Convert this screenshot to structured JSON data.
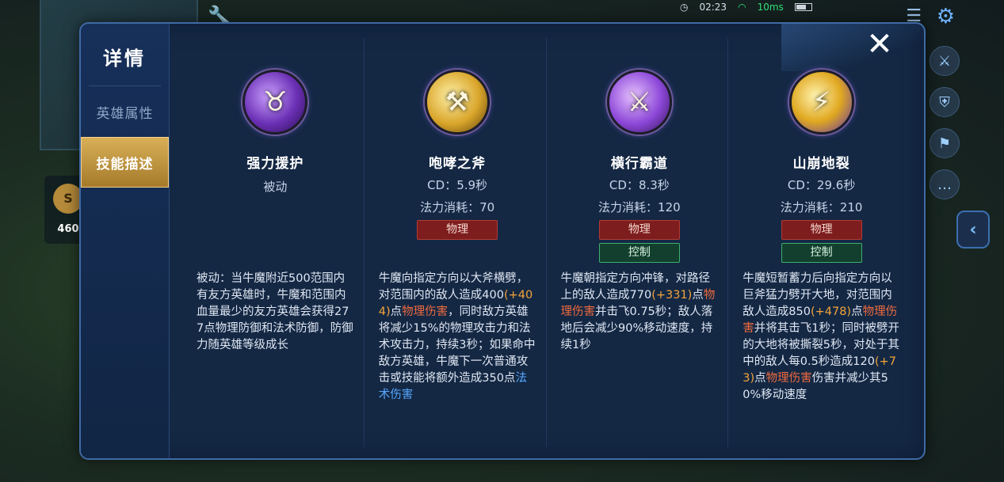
{
  "hud": {
    "time": "02:23",
    "ping": "10ms",
    "gold": "460",
    "gold_symbol": "S"
  },
  "panel": {
    "title": "详情",
    "close_label": "✕",
    "tabs": [
      {
        "label": "英雄属性",
        "active": false
      },
      {
        "label": "技能描述",
        "active": true
      }
    ]
  },
  "skills": [
    {
      "name": "强力援护",
      "type": "被动",
      "icon": "bull-guard-icon",
      "tags": [],
      "desc": [
        {
          "t": "被动：当牛魔附近500范围内有友方英雄时，牛魔和范围内血量最少的友方英雄会获得277点物理防御和法术防御，防御力随英雄等级成长"
        }
      ]
    },
    {
      "name": "咆哮之斧",
      "cd": "CD：5.9秒",
      "mana": "法力消耗：70",
      "icon": "axe-icon",
      "tags": [
        {
          "label": "物理",
          "kind": "phys"
        }
      ],
      "desc": [
        {
          "t": "牛魔向指定方向以大斧横劈，对范围内的敌人造成400"
        },
        {
          "t": "(+404)",
          "c": "num"
        },
        {
          "t": "点"
        },
        {
          "t": "物理伤害",
          "c": "dmg-p"
        },
        {
          "t": "，同时敌方英雄将减少15%的物理攻击力和法术攻击力，持续3秒；如果命中敌方英雄，牛魔下一次普通攻击或技能将额外造成350点"
        },
        {
          "t": "法术伤害",
          "c": "dmg-m"
        }
      ]
    },
    {
      "name": "横行霸道",
      "cd": "CD：8.3秒",
      "mana": "法力消耗：120",
      "icon": "charge-icon",
      "tags": [
        {
          "label": "物理",
          "kind": "phys"
        },
        {
          "label": "控制",
          "kind": "ctrl"
        }
      ],
      "desc": [
        {
          "t": "牛魔朝指定方向冲锋，对路径上的敌人造成770"
        },
        {
          "t": "(+331)",
          "c": "num"
        },
        {
          "t": "点"
        },
        {
          "t": "物理伤害",
          "c": "dmg-p"
        },
        {
          "t": "并击飞0.75秒；敌人落地后会减少90%移动速度，持续1秒"
        }
      ]
    },
    {
      "name": "山崩地裂",
      "cd": "CD：29.6秒",
      "mana": "法力消耗：210",
      "icon": "ground-split-icon",
      "tags": [
        {
          "label": "物理",
          "kind": "phys"
        },
        {
          "label": "控制",
          "kind": "ctrl"
        }
      ],
      "desc": [
        {
          "t": "牛魔短暂蓄力后向指定方向以巨斧猛力劈开大地，对范围内敌人造成850"
        },
        {
          "t": "(+478)",
          "c": "num"
        },
        {
          "t": "点"
        },
        {
          "t": "物理伤害",
          "c": "dmg-p"
        },
        {
          "t": "并将其击飞1秒；同时被劈开的大地将被撕裂5秒，对处于其中的敌人每0.5秒造成120"
        },
        {
          "t": "(+73)",
          "c": "num"
        },
        {
          "t": "点"
        },
        {
          "t": "物理伤害",
          "c": "dmg-p"
        },
        {
          "t": "伤害并减少其50%移动速度"
        }
      ]
    }
  ]
}
